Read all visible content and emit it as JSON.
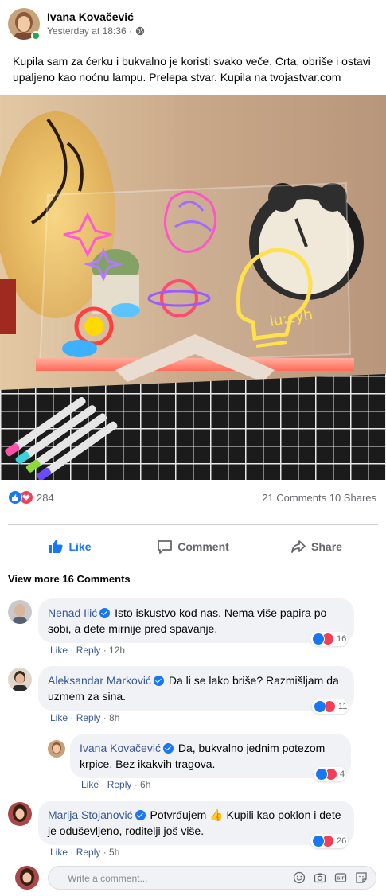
{
  "post": {
    "author": "Ivana Kovačević",
    "timestamp": "Yesterday at 18:36 ·",
    "privacy_icon": "globe-icon",
    "text": "Kupila sam za ćerku i bukvalno je koristi svako veče. Crta, obriše i ostavi upaljeno kao noćnu lampu. Prelepa stvar. Kupila na tvojastvar.com",
    "image_label": "lu:cyh"
  },
  "stats": {
    "reaction_count": "284",
    "comments_shares": "21 Comments 10 Shares",
    "reaction_icons": [
      "like-icon",
      "love-icon"
    ]
  },
  "actions": {
    "like": "Like",
    "comment": "Comment",
    "share": "Share"
  },
  "view_more": "View more 16 Comments",
  "comments": [
    {
      "name": "Nenad Ilić",
      "text": "Isto iskustvo kod nas. Nema više papira po sobi, a dete mirnije pred spavanje.",
      "reactions": "16",
      "like": "Like",
      "reply": "Reply",
      "time": "12h"
    },
    {
      "name": "Aleksandar Marković",
      "text": "Da li se lako briše? Razmišljam da uzmem za sina.",
      "reactions": "11",
      "like": "Like",
      "reply": "Reply",
      "time": "8h"
    },
    {
      "name": "Ivana Kovačević",
      "text": "Da, bukvalno jednim potezom krpice. Bez ikakvih tragova.",
      "reactions": "4",
      "like": "Like",
      "reply": "Reply",
      "time": "6h"
    },
    {
      "name": "Marija Stojanović",
      "text": "Potvrđujem 👍 Kupili kao poklon i dete je oduševljeno, roditelji još više.",
      "reactions": "26",
      "like": "Like",
      "reply": "Reply",
      "time": "5h"
    }
  ],
  "write_comment": {
    "placeholder": "Write a comment..."
  },
  "colors": {
    "brand_blue": "#1877f2",
    "love_red": "#f33e58",
    "link_name": "#385898",
    "muted": "#65676b",
    "bubble_bg": "#f0f2f5"
  }
}
